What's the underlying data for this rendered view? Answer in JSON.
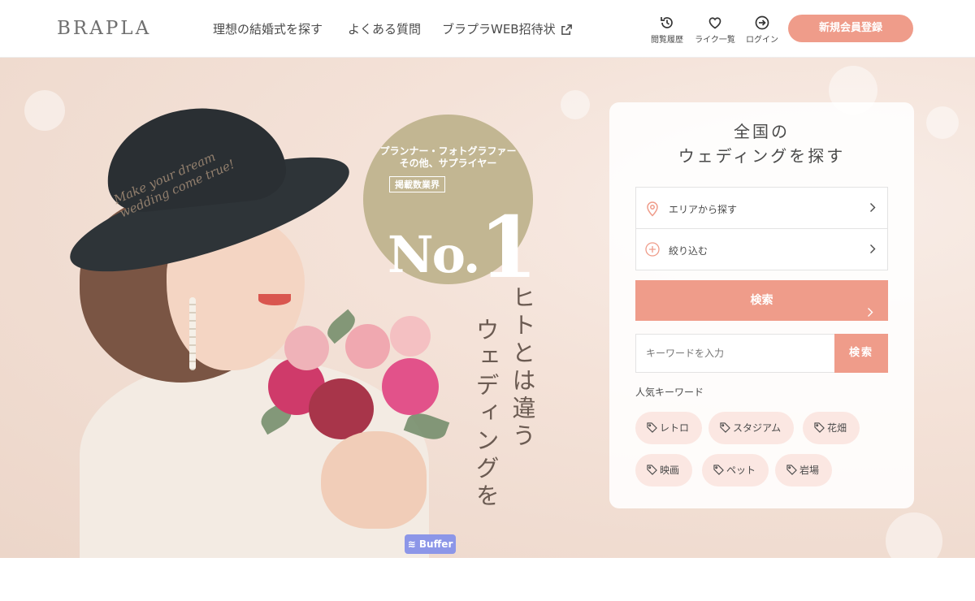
{
  "header": {
    "logo": "BRAPLA",
    "nav": [
      {
        "label": "理想の結婚式を探す"
      },
      {
        "label": "よくある質問"
      },
      {
        "label": "ブラプラWEB招待状"
      }
    ],
    "icons": [
      {
        "label": "閲覧履歴",
        "icon": "history-icon"
      },
      {
        "label": "ライク一覧",
        "icon": "heart-icon"
      },
      {
        "label": "ログイン",
        "icon": "login-icon"
      }
    ],
    "signup_label": "新規会員登録",
    "accent_color": "#ef9c8a"
  },
  "hero": {
    "script_text": "Make your dream\nwedding come true!",
    "badge": {
      "line1": "プランナー・フォトグラファー",
      "line2": "その他、サプライヤー",
      "sub": "掲載数業界",
      "no": "No.",
      "one": "1",
      "color": "#c2b692"
    },
    "copy_line1": "ヒトとは違う",
    "copy_line2": "ウェディングを",
    "buffer_label": "Buffer"
  },
  "search": {
    "title_line1": "全国の",
    "title_line2": "ウェディングを探す",
    "area_label": "エリアから探す",
    "filter_label": "絞り込む",
    "search_label": "検索",
    "keyword_placeholder": "キーワードを入力",
    "keyword_button": "検索",
    "popular_label": "人気キーワード",
    "tags": [
      "レトロ",
      "スタジアム",
      "花畑",
      "映画",
      "ペット",
      "岩場"
    ]
  }
}
